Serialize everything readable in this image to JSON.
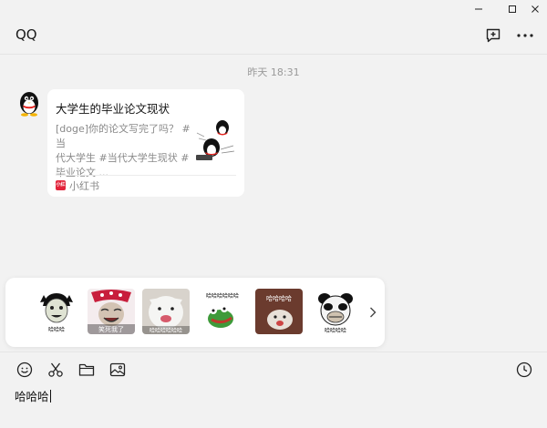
{
  "window": {
    "controls": [
      "minimize-icon",
      "maximize-icon",
      "close-icon"
    ]
  },
  "header": {
    "title": "QQ",
    "actions": [
      "new-chat-icon",
      "more-icon"
    ]
  },
  "chat": {
    "timestamp": "昨天 18:31",
    "message": {
      "title": "大学生的毕业论文现状",
      "desc_line1": "[doge]你的论文写完了吗？ #当",
      "desc_line2": "代大学生 #当代大学生现状 #",
      "desc_line3": "毕业论文 ...",
      "source": "小红书",
      "source_icon_text": "小红书"
    }
  },
  "stickers": [
    {
      "caption": "哈哈哈"
    },
    {
      "caption": "笑死我了"
    },
    {
      "caption": "哈哈哈哈哈哈"
    },
    {
      "caption": "哈哈哈哈哈哈"
    },
    {
      "caption": "哈哈哈哈"
    },
    {
      "caption": "哈哈哈哈"
    }
  ],
  "compose": {
    "tools": [
      "emoji-icon",
      "scissors-icon",
      "folder-icon",
      "image-icon"
    ],
    "history": "clock-icon",
    "input_value": "哈哈哈"
  },
  "colors": {
    "background": "#f2f2f2",
    "card": "#ffffff",
    "brand_red": "#e2233a"
  }
}
